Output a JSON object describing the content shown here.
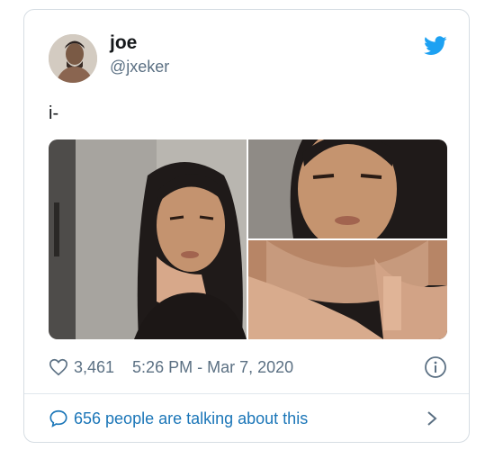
{
  "user": {
    "display_name": "joe",
    "handle": "@jxeker"
  },
  "tweet": {
    "text": "i-"
  },
  "meta": {
    "likes": "3,461",
    "timestamp": "5:26 PM - Mar 7, 2020"
  },
  "footer": {
    "talking": "656 people are talking about this"
  },
  "colors": {
    "twitter_blue": "#1da1f2",
    "link_blue": "#1b76b8",
    "muted_gray": "#5b7083"
  },
  "icons": [
    "twitter-bird-icon",
    "heart-icon",
    "info-icon",
    "speech-bubble-icon",
    "chevron-right-icon"
  ]
}
